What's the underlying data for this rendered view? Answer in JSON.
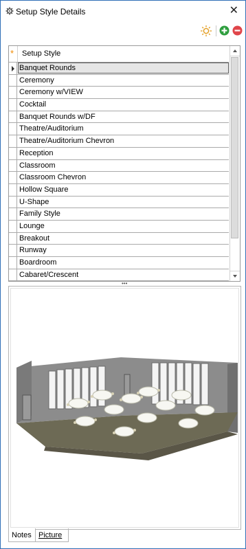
{
  "window": {
    "title": "Setup Style Details",
    "close_symbol": "✕"
  },
  "toolbar": {
    "icons": [
      "sun-icon",
      "add-icon",
      "remove-icon"
    ],
    "add_color": "#2e9e3e",
    "remove_color": "#e0454a"
  },
  "grid": {
    "new_row_marker": "*",
    "column_header": "Setup Style",
    "rows": [
      "Banquet Rounds",
      "Ceremony",
      "Ceremony w/VIEW",
      "Cocktail",
      "Banquet Rounds w/DF",
      "Theatre/Auditorium",
      "Theatre/Auditorium Chevron",
      "Reception",
      "Classroom",
      "Classroom Chevron",
      "Hollow Square",
      "U-Shape",
      "Family Style",
      "Lounge",
      "Breakout",
      "Runway",
      "Boardroom",
      "Cabaret/Crescent"
    ],
    "selected_index": 0
  },
  "splitter": {
    "grip": "•••"
  },
  "tabs": {
    "notes": "Notes",
    "picture": "Picture",
    "active": "notes"
  },
  "colors": {
    "window_border": "#2f6fb6",
    "accent_orange": "#f08a00",
    "grid_line": "#a9a9a9"
  }
}
